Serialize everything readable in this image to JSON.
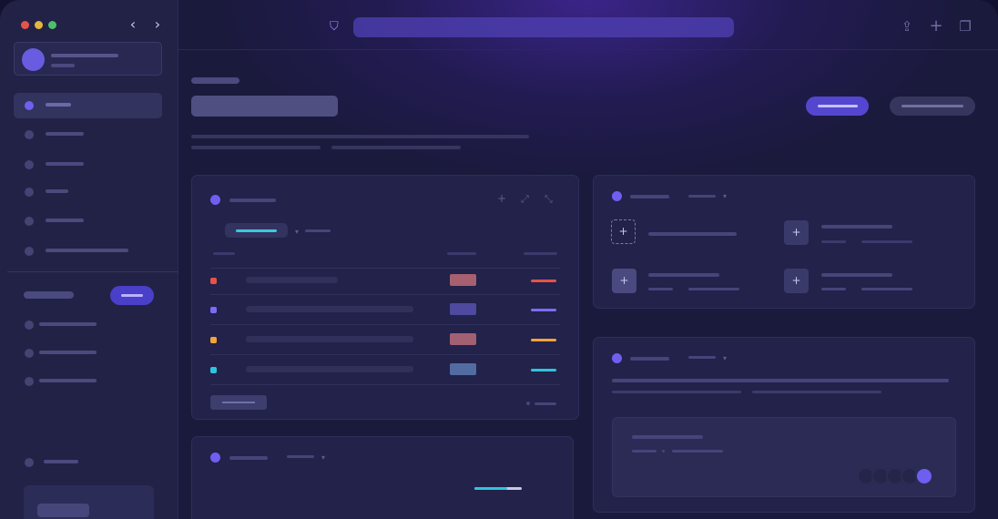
{
  "window": {
    "url": "",
    "icons": {
      "back": "chevron-left-icon",
      "forward": "chevron-right-icon",
      "shield": "shield-icon",
      "share": "share-icon",
      "new_tab": "plus-icon",
      "tabs": "copy-icon"
    }
  },
  "sidebar": {
    "profile": {
      "name": "",
      "subtitle": ""
    },
    "items": [
      {
        "label": "",
        "active": true
      },
      {
        "label": "",
        "active": false
      },
      {
        "label": "",
        "active": false
      },
      {
        "label": "",
        "active": false
      },
      {
        "label": "",
        "active": false
      },
      {
        "label": "",
        "active": false
      }
    ],
    "section": {
      "label": "",
      "button_label": ""
    },
    "section_items": [
      {
        "label": ""
      },
      {
        "label": ""
      },
      {
        "label": ""
      }
    ],
    "bottom_item": {
      "label": ""
    },
    "bottom_card": {
      "button_label": ""
    }
  },
  "header": {
    "breadcrumb": "",
    "title": "",
    "description": [
      "",
      "",
      ""
    ],
    "primary_button": "",
    "secondary_button": ""
  },
  "table_card": {
    "title": "",
    "filter": "",
    "sort": "",
    "columns": [
      "",
      "",
      ""
    ],
    "rows": [
      {
        "name": "",
        "color": "#e5534b",
        "badge_color": "#e07a80"
      },
      {
        "name": "",
        "color": "#7b6cf6",
        "badge_color": "#6e64d8"
      },
      {
        "name": "",
        "color": "#f2a33a",
        "badge_color": "#d97a84"
      },
      {
        "name": "",
        "color": "#2ec4dc",
        "badge_color": "#5f7fb8"
      }
    ],
    "footer_button": "",
    "footer_link": ""
  },
  "bottom_left_card": {
    "title": "",
    "dropdown": "",
    "progress": 0.7
  },
  "actions_card": {
    "title": "",
    "dropdown": "",
    "actions": [
      {
        "title": "",
        "meta": [
          "",
          ""
        ]
      },
      {
        "title": "",
        "meta": [
          "",
          ""
        ]
      },
      {
        "title": "",
        "meta": [
          "",
          ""
        ]
      },
      {
        "title": "",
        "meta": [
          "",
          ""
        ]
      }
    ]
  },
  "detail_card": {
    "title": "",
    "dropdown": "",
    "description": [
      "",
      "",
      ""
    ],
    "inner": {
      "title": "",
      "meta": [
        "",
        ""
      ]
    }
  },
  "colors": {
    "accent": "#6f5ff0",
    "background": "#1a1a3c",
    "sidebar": "#222246"
  }
}
